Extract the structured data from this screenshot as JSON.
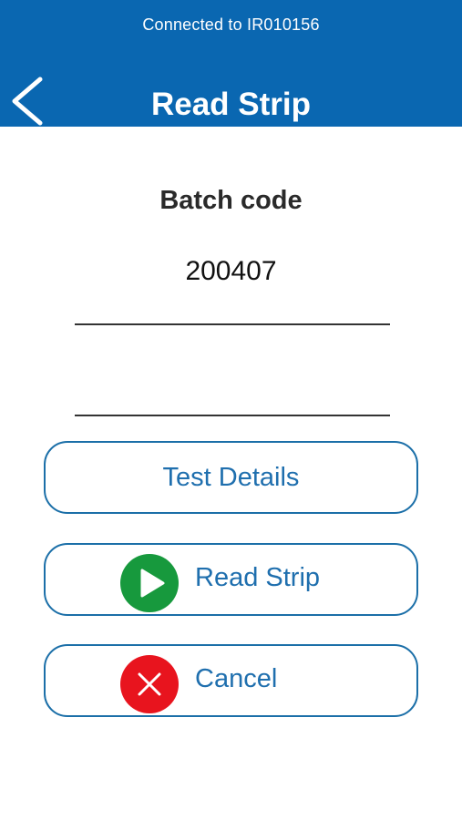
{
  "header": {
    "connection_status": "Connected to IR010156",
    "title": "Read Strip"
  },
  "form": {
    "batch_label": "Batch code",
    "batch_value": "200407"
  },
  "buttons": {
    "test_details": "Test Details",
    "read_strip": "Read Strip",
    "cancel": "Cancel"
  },
  "colors": {
    "header_bg": "#0a67b1",
    "accent": "#1f6fae",
    "play": "#17993d",
    "cancel": "#e8141e"
  },
  "icons": {
    "back": "chevron-left-icon",
    "read_strip": "play-icon",
    "cancel": "close-icon"
  }
}
